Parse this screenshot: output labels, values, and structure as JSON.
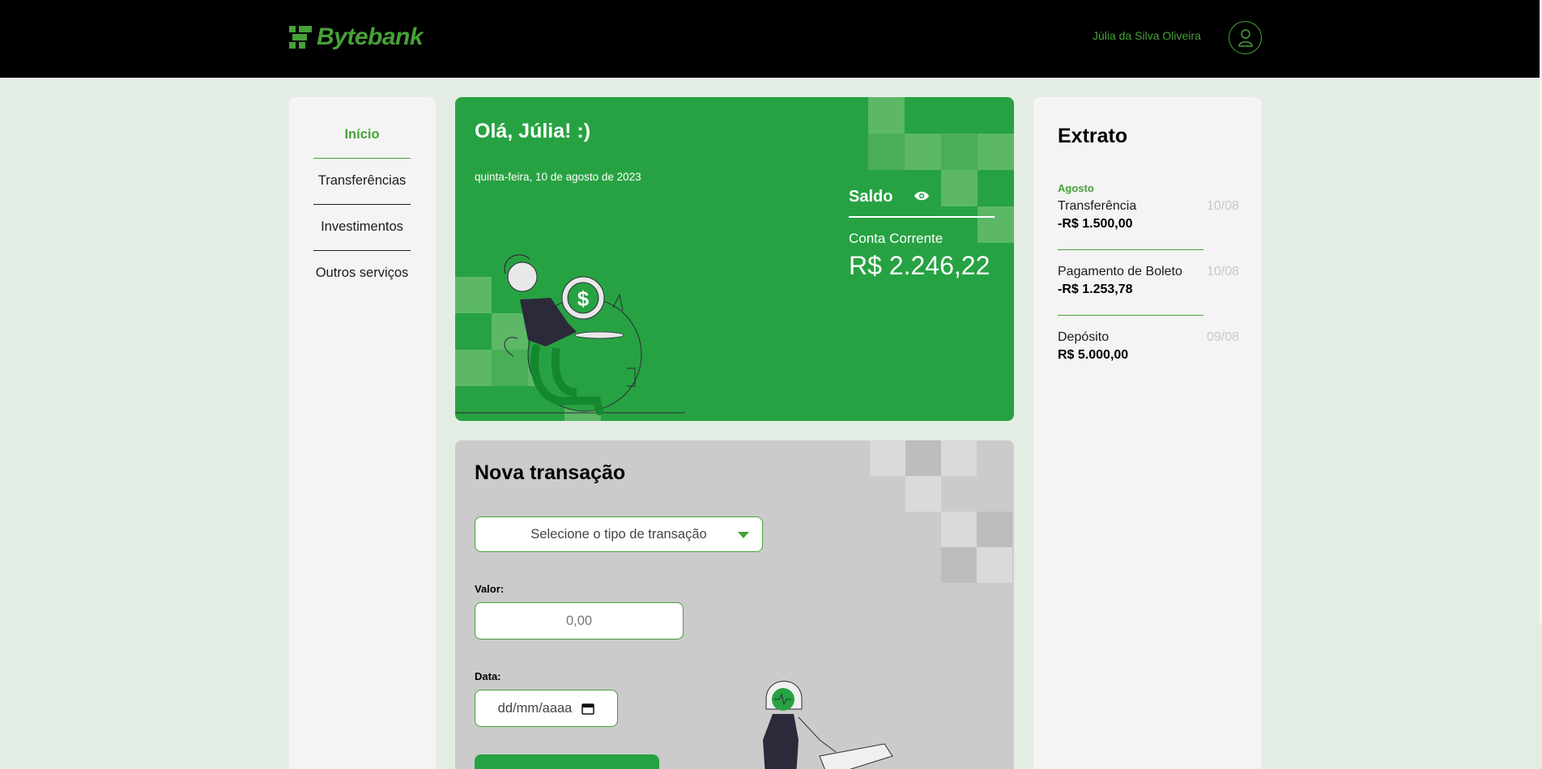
{
  "header": {
    "brand": "Bytebank",
    "user_name": "Júlia da Silva Oliveira"
  },
  "sidebar": {
    "items": [
      {
        "label": "Início",
        "active": true
      },
      {
        "label": "Transferências",
        "active": false
      },
      {
        "label": "Investimentos",
        "active": false
      },
      {
        "label": "Outros serviços",
        "active": false
      }
    ]
  },
  "welcome": {
    "greeting": "Olá, Júlia! :)",
    "date": "quinta-feira, 10 de agosto de 2023",
    "balance_label": "Saldo",
    "account_type": "Conta Corrente",
    "balance": "R$ 2.246,22"
  },
  "transaction": {
    "title": "Nova transação",
    "select_placeholder": "Selecione o tipo de transação",
    "value_label": "Valor:",
    "value_placeholder": "0,00",
    "date_label": "Data:",
    "date_placeholder": "dd/mm/aaaa"
  },
  "statement": {
    "title": "Extrato",
    "month": "Agosto",
    "entries": [
      {
        "name": "Transferência",
        "date": "10/08",
        "amount": "-R$ 1.500,00"
      },
      {
        "name": "Pagamento de Boleto",
        "date": "10/08",
        "amount": "-R$ 1.253,78"
      },
      {
        "name": "Depósito",
        "date": "09/08",
        "amount": "R$ 5.000,00"
      }
    ]
  },
  "colors": {
    "brand_green": "#47a138",
    "card_green": "#27a242",
    "header_bg": "#000000",
    "page_bg": "#e4ede3"
  },
  "icons": [
    "bytebank-logo-icon",
    "user-avatar-icon",
    "eye-icon",
    "dropdown-caret-icon",
    "calendar-icon"
  ]
}
